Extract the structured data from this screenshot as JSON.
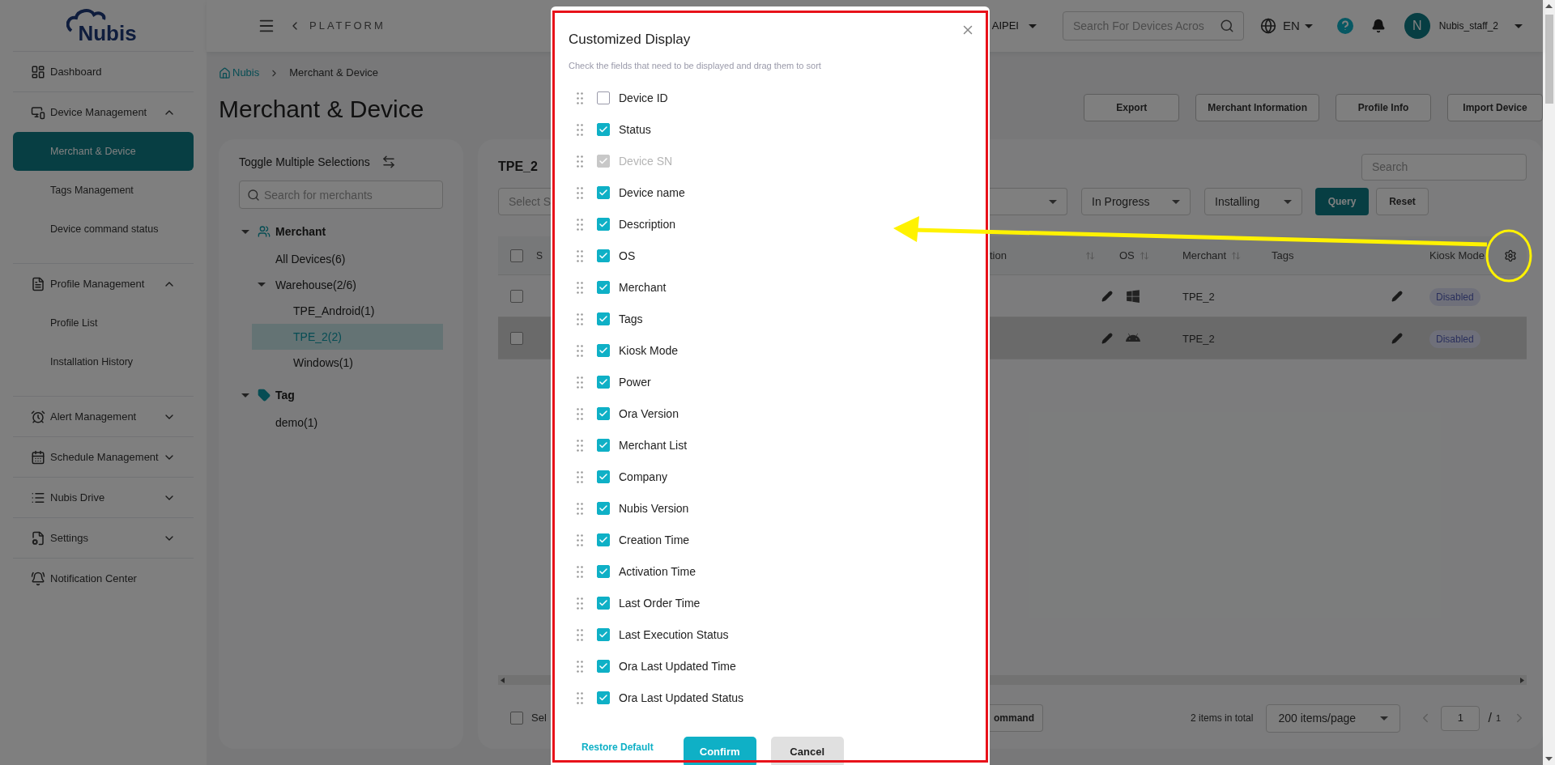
{
  "logo": {
    "text": "Nubis"
  },
  "sidebar": {
    "items": [
      {
        "label": "Dashboard",
        "kind": "link",
        "selected": false
      },
      {
        "label": "Device Management",
        "kind": "group",
        "expanded": true,
        "children": [
          {
            "label": "Merchant & Device",
            "selected": true
          },
          {
            "label": "Tags Management",
            "selected": false
          },
          {
            "label": "Device command status",
            "selected": false
          }
        ]
      },
      {
        "label": "Profile Management",
        "kind": "group",
        "expanded": true,
        "children": [
          {
            "label": "Profile List",
            "selected": false
          },
          {
            "label": "Installation History",
            "selected": false
          }
        ]
      },
      {
        "label": "Alert Management",
        "kind": "group",
        "expanded": false
      },
      {
        "label": "Schedule Management",
        "kind": "group",
        "expanded": false
      },
      {
        "label": "Nubis Drive",
        "kind": "group",
        "expanded": false
      },
      {
        "label": "Settings",
        "kind": "group",
        "expanded": false
      },
      {
        "label": "Notification Center",
        "kind": "link",
        "selected": false
      }
    ]
  },
  "header": {
    "platform": "PLATFORM",
    "region": "AIPEI",
    "search": {
      "placeholder": "Search For Devices Acros"
    },
    "language": "EN",
    "avatar": "N",
    "user": "Nubis_staff_2"
  },
  "breadcrumb": [
    "Nubis",
    "Merchant & Device"
  ],
  "title": "Merchant & Device",
  "actions": [
    "Export",
    "Merchant Information",
    "Profile Info",
    "Import Device"
  ],
  "merchant_panel": {
    "toggle": "Toggle Multiple Selections",
    "search": {
      "placeholder": "Search for merchants"
    },
    "tree": [
      {
        "label": "Merchant",
        "kind": "merchant",
        "expanded": true,
        "children": [
          {
            "label": "All Devices(6)",
            "selected": false
          },
          {
            "label": "Warehouse(2/6)",
            "selected": false,
            "expanded": true,
            "children": [
              {
                "label": "TPE_Android(1)",
                "selected": false
              },
              {
                "label": "TPE_2(2)",
                "selected": true
              },
              {
                "label": "Windows(1)",
                "selected": false
              }
            ]
          }
        ]
      },
      {
        "label": "Tag",
        "kind": "tag",
        "expanded": true,
        "children": [
          {
            "label": "demo(1)",
            "selected": false
          }
        ]
      }
    ]
  },
  "devices_panel": {
    "title": "TPE_2",
    "search": {
      "placeholder": "Search"
    },
    "select_placeholder": "Select S",
    "filters": [
      {
        "value": "In Progress"
      },
      {
        "value": "Installing"
      }
    ],
    "query": "Query",
    "reset": "Reset",
    "table": {
      "column_left": "S",
      "header_checked": false,
      "columns": [
        {
          "label": "tion",
          "sortable": true
        },
        {
          "label": "OS",
          "sortable": true
        },
        {
          "label": "Merchant",
          "sortable": true
        },
        {
          "label": "Tags",
          "sortable": false
        },
        {
          "label": "Kiosk Mode",
          "sortable": false
        }
      ],
      "rows": [
        {
          "checked": false,
          "hovered": false,
          "kind": "windows",
          "merchant": "TPE_2",
          "kiosk_mode": "Disabled"
        },
        {
          "checked": false,
          "hovered": true,
          "kind": "android",
          "merchant": "TPE_2",
          "kiosk_mode": "Disabled"
        }
      ]
    },
    "footer": {
      "select_all": "Sel",
      "select_all_checked": false,
      "command": "ommand",
      "total": "2 items in total",
      "page_size": "200 items/page",
      "page": "1",
      "separator": "/",
      "pages": "1"
    }
  },
  "modal": {
    "title": "Customized Display",
    "subtitle": "Check the fields that need to be displayed and drag them to sort",
    "fields": [
      {
        "label": "Device ID",
        "checked": false,
        "disabled": false
      },
      {
        "label": "Status",
        "checked": true,
        "disabled": false
      },
      {
        "label": "Device SN",
        "checked": true,
        "disabled": true
      },
      {
        "label": "Device name",
        "checked": true,
        "disabled": false
      },
      {
        "label": "Description",
        "checked": true,
        "disabled": false
      },
      {
        "label": "OS",
        "checked": true,
        "disabled": false
      },
      {
        "label": "Merchant",
        "checked": true,
        "disabled": false
      },
      {
        "label": "Tags",
        "checked": true,
        "disabled": false
      },
      {
        "label": "Kiosk Mode",
        "checked": true,
        "disabled": false
      },
      {
        "label": "Power",
        "checked": true,
        "disabled": false
      },
      {
        "label": "Ora Version",
        "checked": true,
        "disabled": false
      },
      {
        "label": "Merchant List",
        "checked": true,
        "disabled": false
      },
      {
        "label": "Company",
        "checked": true,
        "disabled": false
      },
      {
        "label": "Nubis Version",
        "checked": true,
        "disabled": false
      },
      {
        "label": "Creation Time",
        "checked": true,
        "disabled": false
      },
      {
        "label": "Activation Time",
        "checked": true,
        "disabled": false
      },
      {
        "label": "Last Order Time",
        "checked": true,
        "disabled": false
      },
      {
        "label": "Last Execution Status",
        "checked": true,
        "disabled": false
      },
      {
        "label": "Ora Last Updated Time",
        "checked": true,
        "disabled": false
      },
      {
        "label": "Ora Last Updated Status",
        "checked": true,
        "disabled": false
      }
    ],
    "restore": "Restore Default",
    "confirm": "Confirm",
    "cancel": "Cancel"
  }
}
